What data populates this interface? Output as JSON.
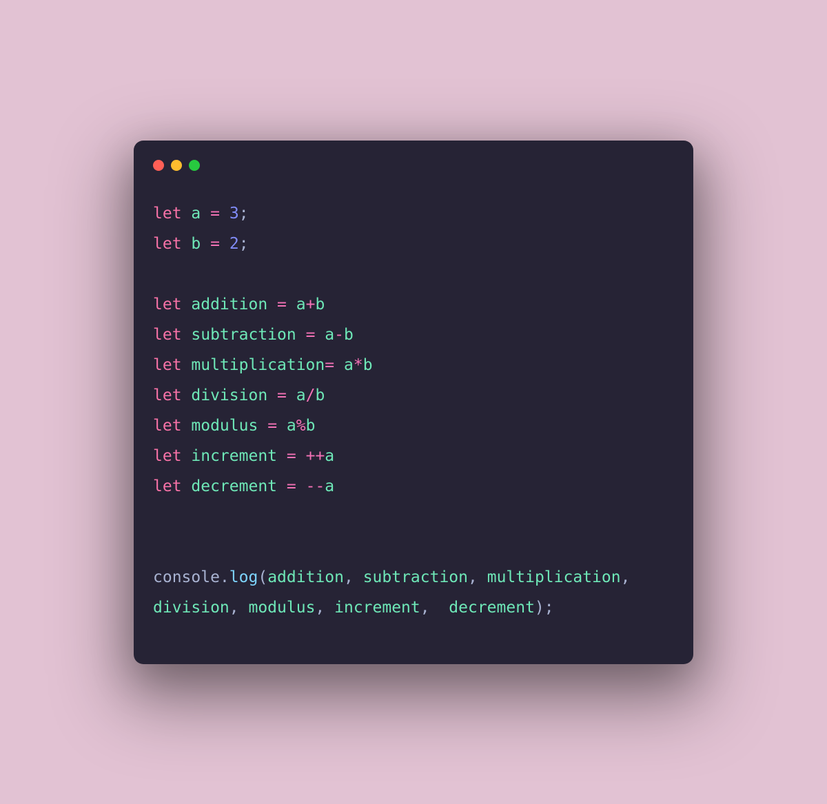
{
  "colors": {
    "background": "#e2c2d3",
    "window": "#262335",
    "dot_red": "#ff5f56",
    "dot_yellow": "#ffbd2e",
    "dot_green": "#27c93f",
    "keyword": "#f772a7",
    "variable": "#6ee7b7",
    "operator": "#f472b6",
    "number": "#818cf8",
    "function": "#7dd3fc",
    "default": "#a8b2d1"
  },
  "code": {
    "lines": [
      {
        "tokens": [
          {
            "t": "let ",
            "c": "kw"
          },
          {
            "t": "a",
            "c": "var"
          },
          {
            "t": " ",
            "c": "punc"
          },
          {
            "t": "=",
            "c": "op"
          },
          {
            "t": " ",
            "c": "punc"
          },
          {
            "t": "3",
            "c": "num"
          },
          {
            "t": ";",
            "c": "punc"
          }
        ]
      },
      {
        "tokens": [
          {
            "t": "let ",
            "c": "kw"
          },
          {
            "t": "b",
            "c": "var"
          },
          {
            "t": " ",
            "c": "punc"
          },
          {
            "t": "=",
            "c": "op"
          },
          {
            "t": " ",
            "c": "punc"
          },
          {
            "t": "2",
            "c": "num"
          },
          {
            "t": ";",
            "c": "punc"
          }
        ]
      },
      {
        "tokens": []
      },
      {
        "tokens": [
          {
            "t": "let ",
            "c": "kw"
          },
          {
            "t": "addition",
            "c": "var"
          },
          {
            "t": " ",
            "c": "punc"
          },
          {
            "t": "=",
            "c": "op"
          },
          {
            "t": " ",
            "c": "punc"
          },
          {
            "t": "a",
            "c": "var"
          },
          {
            "t": "+",
            "c": "op"
          },
          {
            "t": "b",
            "c": "var"
          }
        ]
      },
      {
        "tokens": [
          {
            "t": "let ",
            "c": "kw"
          },
          {
            "t": "subtraction",
            "c": "var"
          },
          {
            "t": " ",
            "c": "punc"
          },
          {
            "t": "=",
            "c": "op"
          },
          {
            "t": " ",
            "c": "punc"
          },
          {
            "t": "a",
            "c": "var"
          },
          {
            "t": "-",
            "c": "op"
          },
          {
            "t": "b",
            "c": "var"
          }
        ]
      },
      {
        "tokens": [
          {
            "t": "let ",
            "c": "kw"
          },
          {
            "t": "multiplication",
            "c": "var"
          },
          {
            "t": "=",
            "c": "op"
          },
          {
            "t": " ",
            "c": "punc"
          },
          {
            "t": "a",
            "c": "var"
          },
          {
            "t": "*",
            "c": "op"
          },
          {
            "t": "b",
            "c": "var"
          }
        ]
      },
      {
        "tokens": [
          {
            "t": "let ",
            "c": "kw"
          },
          {
            "t": "division",
            "c": "var"
          },
          {
            "t": " ",
            "c": "punc"
          },
          {
            "t": "=",
            "c": "op"
          },
          {
            "t": " ",
            "c": "punc"
          },
          {
            "t": "a",
            "c": "var"
          },
          {
            "t": "/",
            "c": "op"
          },
          {
            "t": "b",
            "c": "var"
          }
        ]
      },
      {
        "tokens": [
          {
            "t": "let ",
            "c": "kw"
          },
          {
            "t": "modulus",
            "c": "var"
          },
          {
            "t": " ",
            "c": "punc"
          },
          {
            "t": "=",
            "c": "op"
          },
          {
            "t": " ",
            "c": "punc"
          },
          {
            "t": "a",
            "c": "var"
          },
          {
            "t": "%",
            "c": "op"
          },
          {
            "t": "b",
            "c": "var"
          }
        ]
      },
      {
        "tokens": [
          {
            "t": "let ",
            "c": "kw"
          },
          {
            "t": "increment",
            "c": "var"
          },
          {
            "t": " ",
            "c": "punc"
          },
          {
            "t": "=",
            "c": "op"
          },
          {
            "t": " ",
            "c": "punc"
          },
          {
            "t": "++",
            "c": "op"
          },
          {
            "t": "a",
            "c": "var"
          }
        ]
      },
      {
        "tokens": [
          {
            "t": "let ",
            "c": "kw"
          },
          {
            "t": "decrement",
            "c": "var"
          },
          {
            "t": " ",
            "c": "punc"
          },
          {
            "t": "=",
            "c": "op"
          },
          {
            "t": " ",
            "c": "punc"
          },
          {
            "t": "--",
            "c": "op"
          },
          {
            "t": "a",
            "c": "var"
          }
        ]
      },
      {
        "tokens": []
      },
      {
        "tokens": []
      },
      {
        "tokens": [
          {
            "t": "console",
            "c": "obj"
          },
          {
            "t": ".",
            "c": "punc"
          },
          {
            "t": "log",
            "c": "func"
          },
          {
            "t": "(",
            "c": "punc"
          },
          {
            "t": "addition",
            "c": "var"
          },
          {
            "t": ", ",
            "c": "punc"
          },
          {
            "t": "subtraction",
            "c": "var"
          },
          {
            "t": ", ",
            "c": "punc"
          },
          {
            "t": "multiplication",
            "c": "var"
          },
          {
            "t": ", ",
            "c": "punc"
          },
          {
            "t": "division",
            "c": "var"
          },
          {
            "t": ", ",
            "c": "punc"
          },
          {
            "t": "modulus",
            "c": "var"
          },
          {
            "t": ", ",
            "c": "punc"
          },
          {
            "t": "increment",
            "c": "var"
          },
          {
            "t": ",  ",
            "c": "punc"
          },
          {
            "t": "decrement",
            "c": "var"
          },
          {
            "t": ");",
            "c": "punc"
          }
        ]
      }
    ]
  }
}
